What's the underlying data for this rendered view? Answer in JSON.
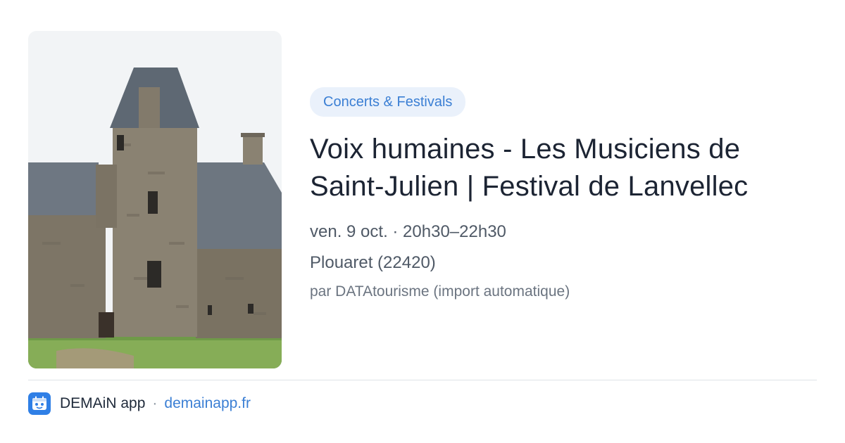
{
  "event": {
    "category": "Concerts & Festivals",
    "title_line1": "Voix humaines - Les Musiciens de",
    "title_line2": "Saint-Julien | Festival de Lanvellec",
    "datetime": "ven. 9 oct. · 20h30–22h30",
    "location": "Plouaret (22420)",
    "organizer": "par DATAtourisme (import automatique)"
  },
  "footer": {
    "app_name": "DEMAiN app",
    "separator": "·",
    "link": "demainapp.fr",
    "icon": "demain-app-icon"
  },
  "colors": {
    "accent": "#3b7fd4",
    "pill_bg": "#eaf1fb",
    "text_primary": "#1c2433",
    "text_secondary": "#4f5966"
  }
}
